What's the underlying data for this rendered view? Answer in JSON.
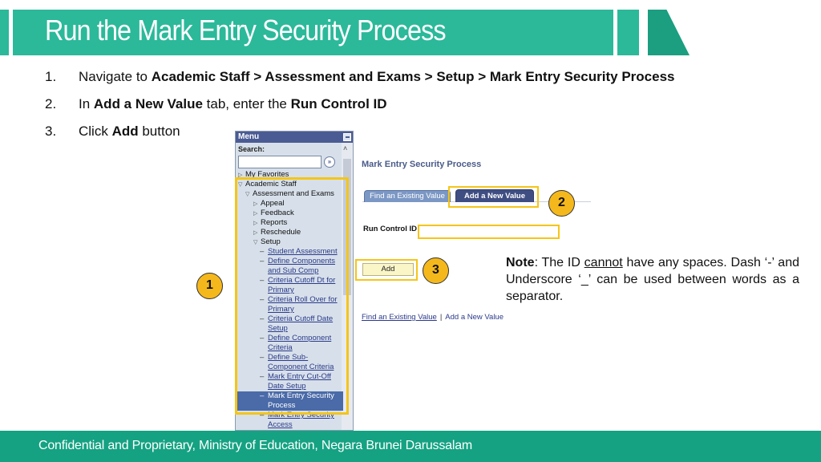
{
  "slide": {
    "title": "Run the Mark Entry Security Process",
    "footer": "Confidential and Proprietary, Ministry of Education, Negara Brunei Darussalam"
  },
  "steps": [
    {
      "num": "1.",
      "parts": [
        {
          "text": "Navigate to ",
          "bold": false
        },
        {
          "text": "Academic Staff > Assessment and Exams > Setup > Mark Entry Security Process",
          "bold": true
        }
      ]
    },
    {
      "num": "2.",
      "parts": [
        {
          "text": "In ",
          "bold": false
        },
        {
          "text": "Add a New Value",
          "bold": true
        },
        {
          "text": " tab, enter the ",
          "bold": false
        },
        {
          "text": "Run Control ID",
          "bold": true
        }
      ]
    },
    {
      "num": "3.",
      "parts": [
        {
          "text": "Click ",
          "bold": false
        },
        {
          "text": "Add",
          "bold": true
        },
        {
          "text": " button",
          "bold": false
        }
      ]
    }
  ],
  "menu": {
    "header": "Menu",
    "search_label": "Search:",
    "search_value": "",
    "go_icon": "»",
    "tree": [
      {
        "label": "My Favorites",
        "level": 0,
        "expanded": false
      },
      {
        "label": "Academic Staff",
        "level": 0,
        "expanded": true
      },
      {
        "label": "Assessment and Exams",
        "level": 1,
        "expanded": true
      },
      {
        "label": "Appeal",
        "level": 2,
        "expanded": false
      },
      {
        "label": "Feedback",
        "level": 2,
        "expanded": false
      },
      {
        "label": "Reports",
        "level": 2,
        "expanded": false
      },
      {
        "label": "Reschedule",
        "level": 2,
        "expanded": false
      },
      {
        "label": "Setup",
        "level": 2,
        "expanded": true
      }
    ],
    "leaves": [
      {
        "label": "Student Assessment",
        "selected": false
      },
      {
        "label": "Define Components and Sub Comp",
        "selected": false
      },
      {
        "label": "Criteria Cutoff Dt for Primary",
        "selected": false
      },
      {
        "label": "Criteria Roll Over for Primary",
        "selected": false
      },
      {
        "label": "Criteria Cutoff Date Setup",
        "selected": false
      },
      {
        "label": "Define Component Criteria",
        "selected": false
      },
      {
        "label": "Define Sub-Component Criteria",
        "selected": false
      },
      {
        "label": "Mark Entry Cut-Off Date Setup",
        "selected": false
      },
      {
        "label": "Mark Entry Security Process",
        "selected": true
      },
      {
        "label": "Mark Entry Security Access",
        "selected": false
      }
    ]
  },
  "page": {
    "title": "Mark Entry Security Process",
    "tabs": [
      {
        "label": "Find an Existing Value",
        "active": false
      },
      {
        "label": "Add a New Value",
        "active": true
      }
    ],
    "run_control_label": "Run Control ID",
    "run_control_value": "",
    "add_button": "Add",
    "links": [
      "Find an Existing Value",
      "Add a New Value"
    ],
    "link_separator": "|"
  },
  "callouts": [
    "1",
    "2",
    "3"
  ],
  "note": {
    "label": "Note",
    "text_1": ": The ID ",
    "emphasis": "cannot",
    "text_2": " have any spaces. Dash ‘-’ and Underscore ‘_’ can be used between words as a separator."
  },
  "colors": {
    "banner": "#2bb99a",
    "footer": "#15a282",
    "highlight": "#f5c518",
    "callout": "#f5b81c",
    "menu_header": "#4a5b94"
  }
}
